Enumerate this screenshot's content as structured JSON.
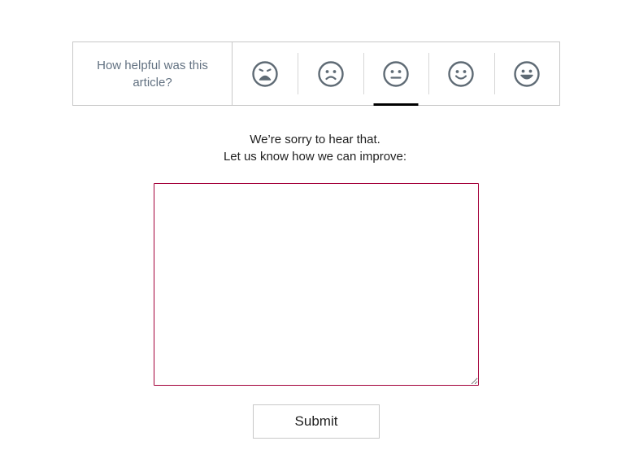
{
  "rating": {
    "question": "How helpful was this article?",
    "faces": [
      {
        "icon": "very-sad-face-icon"
      },
      {
        "icon": "sad-face-icon"
      },
      {
        "icon": "neutral-face-icon",
        "selected": true
      },
      {
        "icon": "happy-face-icon"
      },
      {
        "icon": "very-happy-face-icon"
      }
    ],
    "icon_color": "#5f6b75",
    "selected_indicator_color": "#000000"
  },
  "feedback": {
    "line1": "We’re sorry to hear that.",
    "line2": "Let us know how we can improve:",
    "value": "",
    "border_color": "#a4003a"
  },
  "submit": {
    "label": "Submit"
  }
}
